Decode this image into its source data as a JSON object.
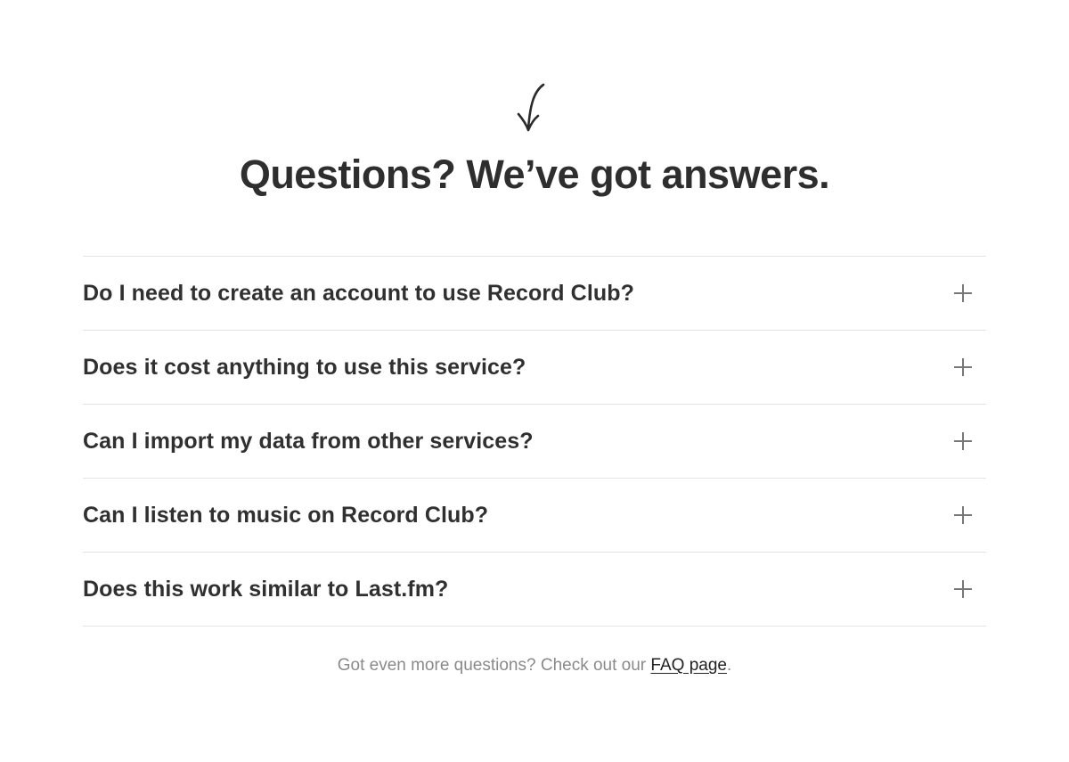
{
  "header": {
    "arrow_icon": "hand-drawn-arrow-down-icon",
    "title": "Questions? We’ve got answers."
  },
  "faq": {
    "items": [
      {
        "question": "Do I need to create an account to use Record Club?",
        "icon": "plus-icon"
      },
      {
        "question": "Does it cost anything to use this service?",
        "icon": "plus-icon"
      },
      {
        "question": "Can I import my data from other services?",
        "icon": "plus-icon"
      },
      {
        "question": "Can I listen to music on Record Club?",
        "icon": "plus-icon"
      },
      {
        "question": "Does this work similar to Last.fm?",
        "icon": "plus-icon"
      }
    ]
  },
  "footer": {
    "prefix": "Got even more questions? Check out our ",
    "link_label": "FAQ page",
    "suffix": "."
  },
  "colors": {
    "text": "#2e2e2e",
    "muted": "#8a8a8a",
    "divider": "#e3e3e3",
    "icon": "#777777"
  }
}
